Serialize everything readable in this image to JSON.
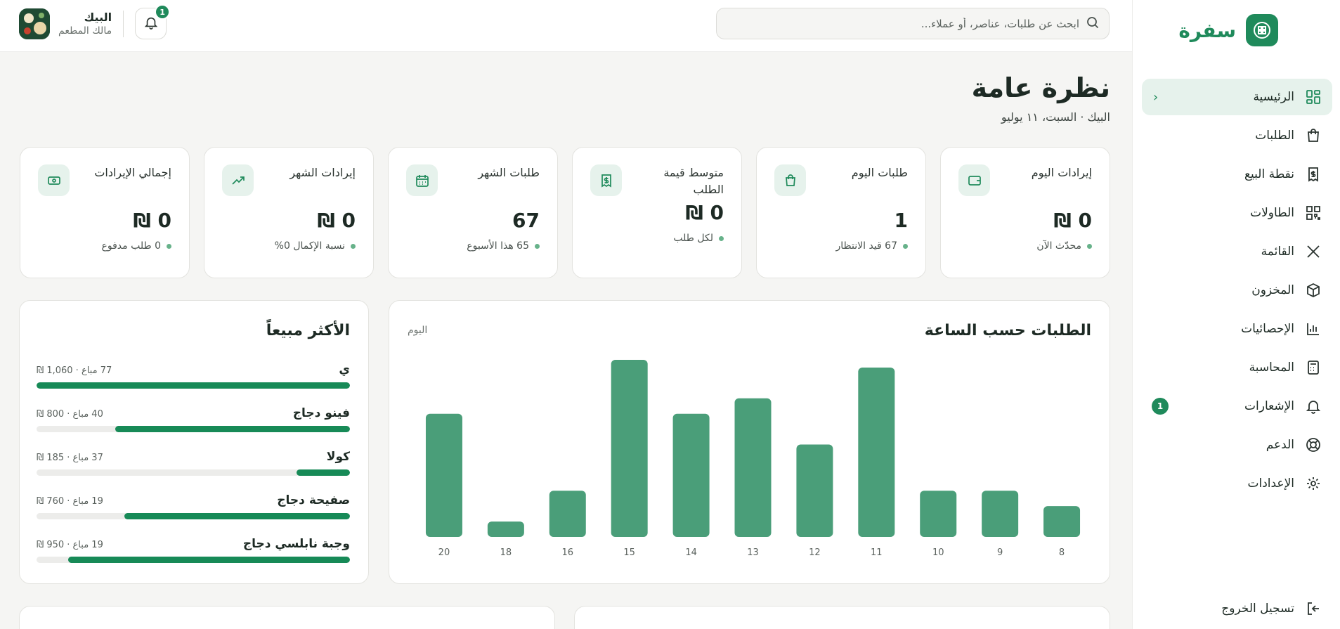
{
  "brand": {
    "name": "سفرة",
    "logo_icon": "qr-plate-icon",
    "accent": "#1f8a5b"
  },
  "sidebar": {
    "items": [
      {
        "label": "الرئيسية",
        "icon": "dashboard-icon",
        "active": true
      },
      {
        "label": "الطلبات",
        "icon": "shopping-bag-icon"
      },
      {
        "label": "نقطة البيع",
        "icon": "receipt-icon"
      },
      {
        "label": "الطاولات",
        "icon": "qr-code-icon"
      },
      {
        "label": "القائمة",
        "icon": "utensils-icon"
      },
      {
        "label": "المخزون",
        "icon": "box-icon"
      },
      {
        "label": "الإحصائيات",
        "icon": "bar-chart-icon"
      },
      {
        "label": "المحاسبة",
        "icon": "calculator-icon"
      },
      {
        "label": "الإشعارات",
        "icon": "bell-icon",
        "badge": "1"
      },
      {
        "label": "الدعم",
        "icon": "lifebuoy-icon"
      },
      {
        "label": "الإعدادات",
        "icon": "gear-icon"
      }
    ],
    "logout_label": "تسجيل الخروج"
  },
  "topbar": {
    "search_placeholder": "ابحث عن طلبات، عناصر، أو عملاء...",
    "notifications_count": "1",
    "user_name": "البيك",
    "user_role": "مالك المطعم"
  },
  "page": {
    "title": "نظرة عامة",
    "subtitle": "البيك · السبت، ١١ يوليو"
  },
  "stats": [
    {
      "title": "إيرادات اليوم",
      "value": "0 ₪",
      "note": "محدّث الآن",
      "icon": "wallet-icon"
    },
    {
      "title": "طلبات اليوم",
      "value": "1",
      "note": "67 قيد الانتظار",
      "icon": "bag-icon"
    },
    {
      "title": "متوسط قيمة الطلب",
      "value": "0 ₪",
      "note": "لكل طلب",
      "icon": "receipt-dollar-icon"
    },
    {
      "title": "طلبات الشهر",
      "value": "67",
      "note": "65 هذا الأسبوع",
      "icon": "calendar-icon"
    },
    {
      "title": "إيرادات الشهر",
      "value": "0 ₪",
      "note": "نسبة الإكمال 0%",
      "icon": "trending-up-icon"
    },
    {
      "title": "إجمالي الإيرادات",
      "value": "0 ₪",
      "note": "0 طلب مدفوع",
      "icon": "cash-icon"
    }
  ],
  "hourly": {
    "title": "الطلبات حسب الساعة",
    "period": "اليوم"
  },
  "chart_data": {
    "type": "bar",
    "categories": [
      "8",
      "9",
      "10",
      "11",
      "12",
      "13",
      "14",
      "15",
      "16",
      "18",
      "20"
    ],
    "values": [
      4,
      6,
      6,
      22,
      12,
      18,
      16,
      23,
      6,
      2,
      16
    ],
    "ylim": [
      0,
      23
    ],
    "grid": false,
    "color": "#4a9e79"
  },
  "top_sellers": {
    "title": "الأكثر مبيعاً",
    "items": [
      {
        "name": "ي",
        "meta": "77 مباع · 1,060 ₪",
        "fraction": 1.0
      },
      {
        "name": "فينو دجاج",
        "meta": "40 مباع · 800 ₪",
        "fraction": 0.75
      },
      {
        "name": "كولا",
        "meta": "37 مباع · 185 ₪",
        "fraction": 0.17
      },
      {
        "name": "صفيحة دجاج",
        "meta": "19 مباع · 760 ₪",
        "fraction": 0.72
      },
      {
        "name": "وجبة نابلسي دجاج",
        "meta": "19 مباع · 950 ₪",
        "fraction": 0.9
      }
    ]
  }
}
